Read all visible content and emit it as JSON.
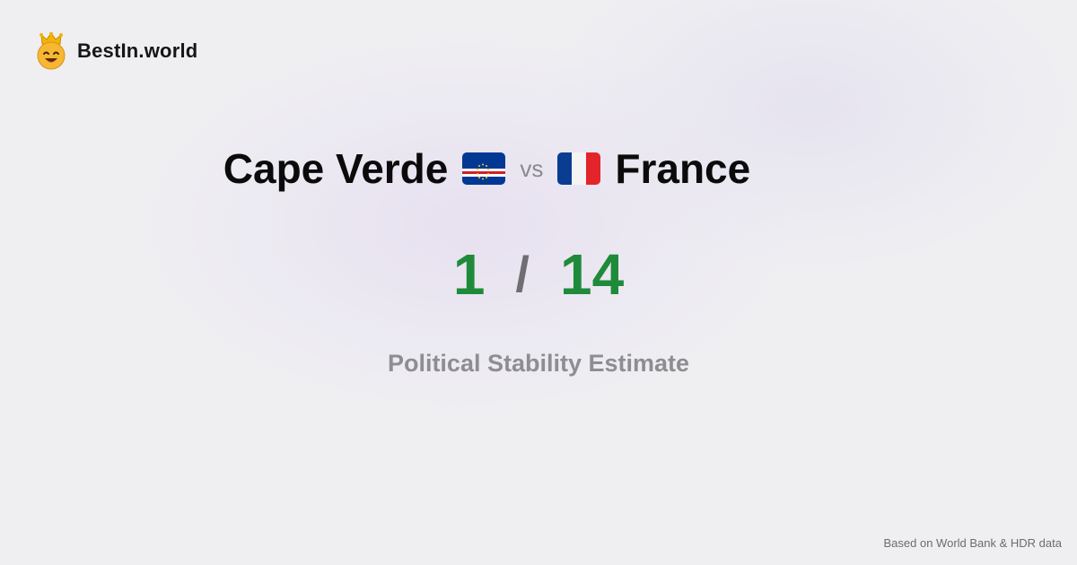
{
  "brand": {
    "name": "BestIn.world",
    "logo_icon": "crowned-smiley-icon"
  },
  "comparison": {
    "left_country": "Cape Verde",
    "left_flag": "cape-verde-flag-icon",
    "vs_label": "vs",
    "right_country": "France",
    "right_flag": "france-flag-icon"
  },
  "scores": {
    "left_rank": "1",
    "separator": "/",
    "right_rank": "14"
  },
  "metric": {
    "label": "Political Stability Estimate"
  },
  "footer": {
    "source_note": "Based on World Bank & HDR data"
  },
  "colors": {
    "score_green": "#1f8b3a",
    "background": "#efeff2",
    "muted_text": "#8e8e92"
  }
}
